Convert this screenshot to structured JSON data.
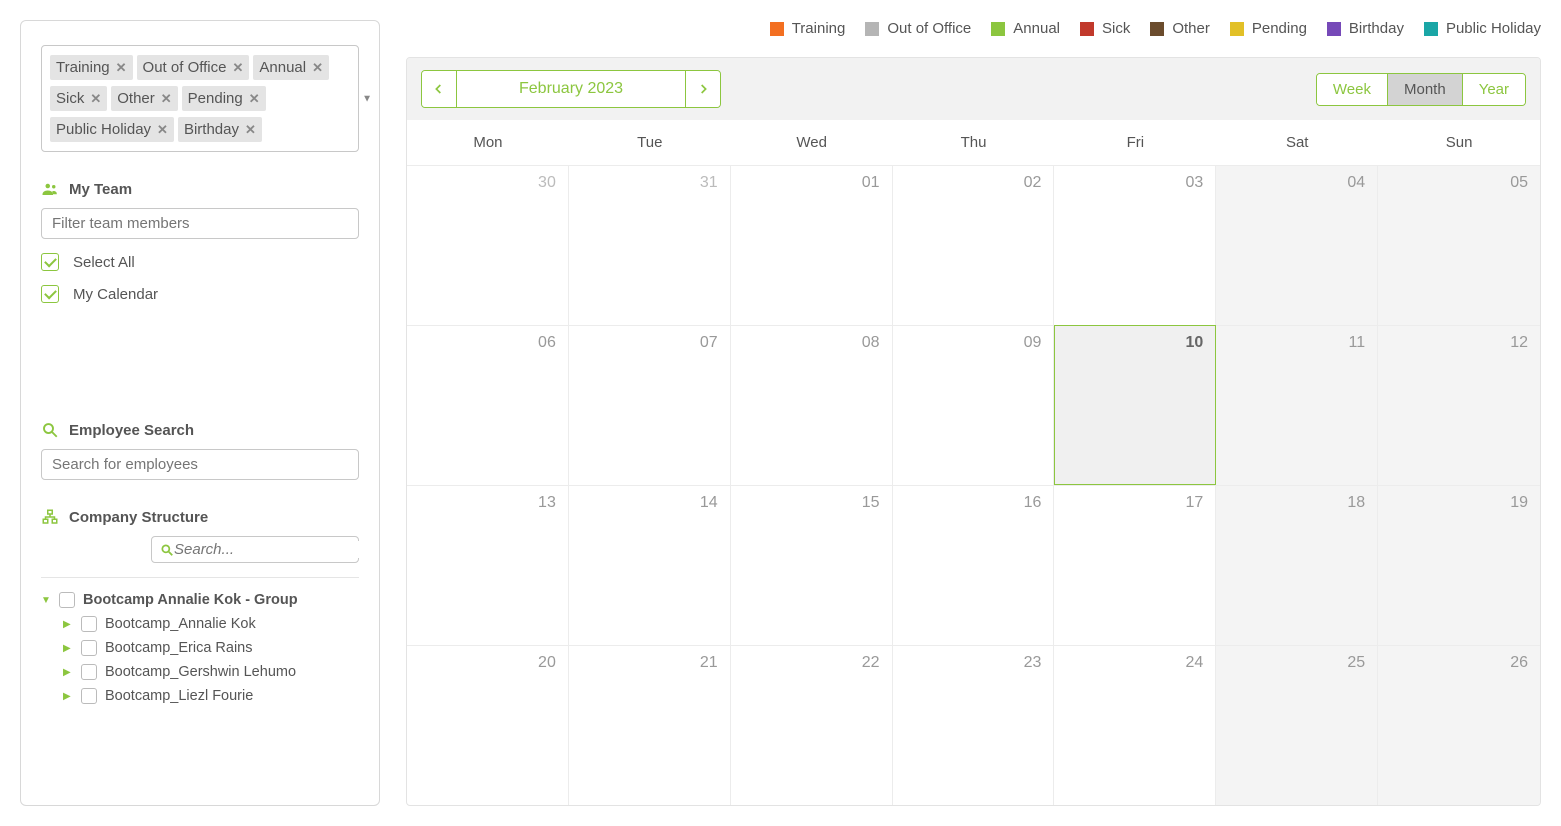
{
  "sidebar": {
    "tags": [
      "Training",
      "Out of Office",
      "Annual",
      "Sick",
      "Other",
      "Pending",
      "Public Holiday",
      "Birthday"
    ],
    "sections": {
      "my_team": "My Team",
      "employee_search": "Employee Search",
      "company_structure": "Company Structure"
    },
    "filter_placeholder": "Filter team members",
    "select_all": "Select All",
    "my_calendar": "My Calendar",
    "emp_search_placeholder": "Search for employees",
    "company_search_placeholder": "Search...",
    "tree": {
      "group": "Bootcamp Annalie Kok - Group",
      "children": [
        "Bootcamp_Annalie Kok",
        "Bootcamp_Erica Rains",
        "Bootcamp_Gershwin Lehumo",
        "Bootcamp_Liezl Fourie"
      ]
    }
  },
  "legend": [
    {
      "label": "Training",
      "color": "#f36f21"
    },
    {
      "label": "Out of Office",
      "color": "#b5b5b5"
    },
    {
      "label": "Annual",
      "color": "#8cc63f"
    },
    {
      "label": "Sick",
      "color": "#c1392b"
    },
    {
      "label": "Other",
      "color": "#6b4c2d"
    },
    {
      "label": "Pending",
      "color": "#e2c027"
    },
    {
      "label": "Birthday",
      "color": "#7649b8"
    },
    {
      "label": "Public Holiday",
      "color": "#1aa6a6"
    }
  ],
  "calendar": {
    "title": "February 2023",
    "views": {
      "week": "Week",
      "month": "Month",
      "year": "Year"
    },
    "active_view": "month",
    "dow": [
      "Mon",
      "Tue",
      "Wed",
      "Thu",
      "Fri",
      "Sat",
      "Sun"
    ],
    "cells": [
      {
        "n": "30",
        "other": true
      },
      {
        "n": "31",
        "other": true
      },
      {
        "n": "01"
      },
      {
        "n": "02"
      },
      {
        "n": "03"
      },
      {
        "n": "04",
        "weekend": true
      },
      {
        "n": "05",
        "weekend": true
      },
      {
        "n": "06"
      },
      {
        "n": "07"
      },
      {
        "n": "08"
      },
      {
        "n": "09"
      },
      {
        "n": "10",
        "today": true
      },
      {
        "n": "11",
        "weekend": true
      },
      {
        "n": "12",
        "weekend": true
      },
      {
        "n": "13"
      },
      {
        "n": "14"
      },
      {
        "n": "15"
      },
      {
        "n": "16"
      },
      {
        "n": "17"
      },
      {
        "n": "18",
        "weekend": true
      },
      {
        "n": "19",
        "weekend": true
      },
      {
        "n": "20"
      },
      {
        "n": "21"
      },
      {
        "n": "22"
      },
      {
        "n": "23"
      },
      {
        "n": "24"
      },
      {
        "n": "25",
        "weekend": true
      },
      {
        "n": "26",
        "weekend": true
      }
    ]
  }
}
